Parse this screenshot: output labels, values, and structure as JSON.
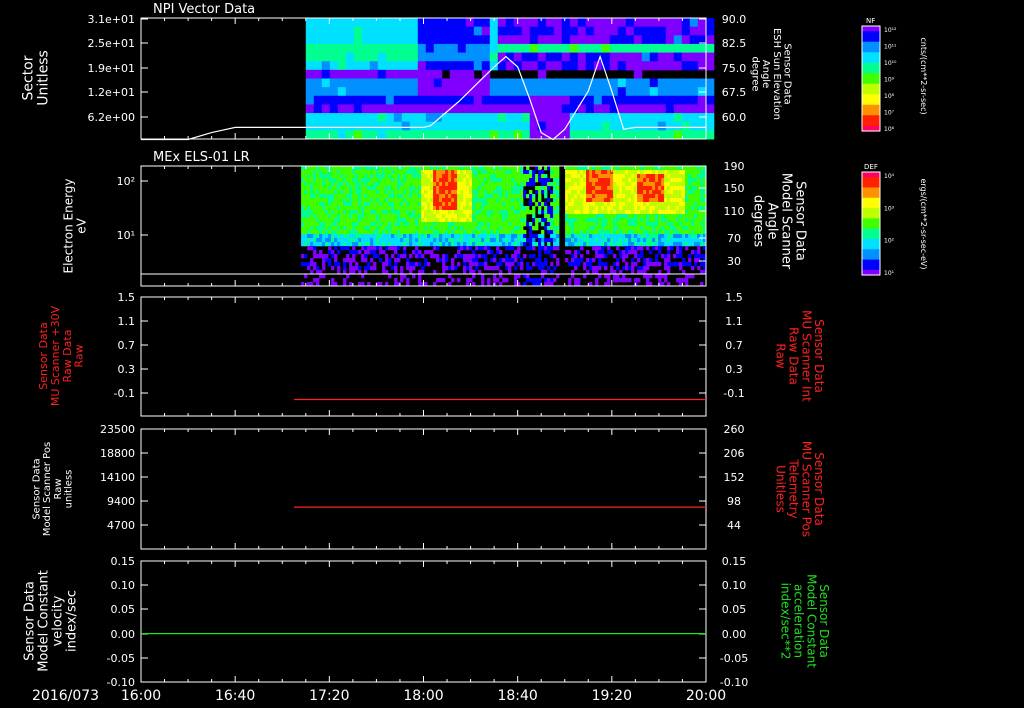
{
  "footer": {
    "date": "2016/073",
    "time_ticks": [
      "16:00",
      "16:40",
      "17:20",
      "18:00",
      "18:40",
      "19:20",
      "20:00"
    ]
  },
  "colors": {
    "white": "#ffffff",
    "red": "#ff2020",
    "green": "#20e020",
    "colormap": [
      "#8000ff",
      "#0000ff",
      "#0090ff",
      "#00e0ff",
      "#00ff90",
      "#40ff00",
      "#c0ff00",
      "#ffff00",
      "#ff9000",
      "#ff2000",
      "#ff0060"
    ]
  },
  "chart_data": [
    {
      "type": "heatmap",
      "title": "NPI Vector Data",
      "ylabel": "Sector\nUnitless",
      "y_ticks": [
        "3.1e+01",
        "2.5e+01",
        "1.9e+01",
        "1.2e+01",
        "6.2e+00"
      ],
      "right_label": "Sensor Data\nESH Sun Elevation\nAngle\ndegree",
      "right_ticks": [
        "90.0",
        "82.5",
        "75.0",
        "67.5",
        "60.0"
      ],
      "ylim_right": [
        55,
        90
      ],
      "colorbar": {
        "title": "NF",
        "ticks": [
          "10¹²",
          "10¹¹",
          "10¹⁰",
          "10⁹",
          "10⁸",
          "10⁷",
          "10⁶"
        ],
        "units": "cnts/(cm**2-sr-sec)"
      },
      "overlay_line": {
        "name": "Sensor Data ESH Sun Elevation Angle",
        "x": [
          "16:00",
          "16:20",
          "16:30",
          "16:40",
          "17:20",
          "18:00",
          "18:03",
          "18:15",
          "18:30",
          "18:35",
          "18:40",
          "18:45",
          "18:50",
          "18:55",
          "19:00",
          "19:10",
          "19:15",
          "19:20",
          "19:25",
          "19:30",
          "20:00"
        ],
        "y": [
          56,
          56,
          58,
          59.5,
          59.5,
          59.5,
          60,
          67,
          77,
          80,
          77,
          68,
          58,
          56,
          59,
          70,
          80,
          70,
          59,
          59.5,
          59.5
        ]
      }
    },
    {
      "type": "heatmap",
      "title": "MEx ELS-01 LR",
      "ylabel": "Electron Energy\neV",
      "y_ticks": [
        "10²",
        "10¹"
      ],
      "right_label": "Sensor Data\nModel Scanner\nAngle\ndegrees",
      "right_ticks": [
        "190",
        "150",
        "110",
        "70",
        "30"
      ],
      "ylim_right": [
        -10,
        190
      ],
      "colorbar": {
        "title": "DEF",
        "ticks": [
          "10⁴",
          "10³",
          "10²",
          "10¹"
        ],
        "units": "ergs/(cm**2-sr-sec-eV)"
      },
      "overlay_line": {
        "name": "Sensor Data Model Scanner Angle",
        "x": [
          "16:00",
          "20:00"
        ],
        "y": [
          0,
          0
        ]
      }
    },
    {
      "type": "line",
      "ylabel": "Sensor Data\nMU Scanner +30V\nRaw Data\nRaw",
      "y_ticks": [
        "1.5",
        "1.1",
        "0.7",
        "0.3",
        "-0.1"
      ],
      "ylim": [
        -0.3,
        1.5
      ],
      "right_label": "Sensor Data\nMU Scanner Int\nRaw Data\nRaw",
      "right_ticks": [
        "1.5",
        "1.1",
        "0.7",
        "0.3",
        "-0.1"
      ],
      "series": [
        {
          "name": "Sensor Data MU Scanner Int Raw Data",
          "x": [
            "17:05",
            "20:00"
          ],
          "y": [
            -0.05,
            -0.05
          ]
        }
      ]
    },
    {
      "type": "line",
      "ylabel": "Sensor Data\nModel Scanner Pos\nRaw\nunitless",
      "y_ticks": [
        "23500",
        "18800",
        "14100",
        "9400",
        "4700"
      ],
      "ylim": [
        0,
        23500
      ],
      "right_label": "Sensor Data\nMU Scanner Pos\nTelemetry\nUnitless",
      "right_ticks": [
        "260",
        "206",
        "152",
        "98",
        "44"
      ],
      "series": [
        {
          "name": "Sensor Data MU Scanner Pos Telemetry",
          "x": [
            "17:05",
            "20:00"
          ],
          "y": [
            8200,
            8200
          ]
        }
      ]
    },
    {
      "type": "line",
      "ylabel": "Sensor Data\nModel Constant\nvelocity\nindex/sec",
      "y_ticks": [
        "0.15",
        "0.10",
        "0.05",
        "0.00",
        "-0.05",
        "-0.10"
      ],
      "ylim": [
        -0.1,
        0.15
      ],
      "right_label": "Sensor Data\nModel Constant\nacceleration\nindex/sec**2",
      "right_ticks": [
        "0.15",
        "0.10",
        "0.05",
        "0.00",
        "-0.05",
        "-0.10"
      ],
      "series": [
        {
          "name": "Sensor Data Model Constant acceleration",
          "x": [
            "16:00",
            "20:00"
          ],
          "y": [
            0,
            0
          ]
        }
      ]
    }
  ]
}
